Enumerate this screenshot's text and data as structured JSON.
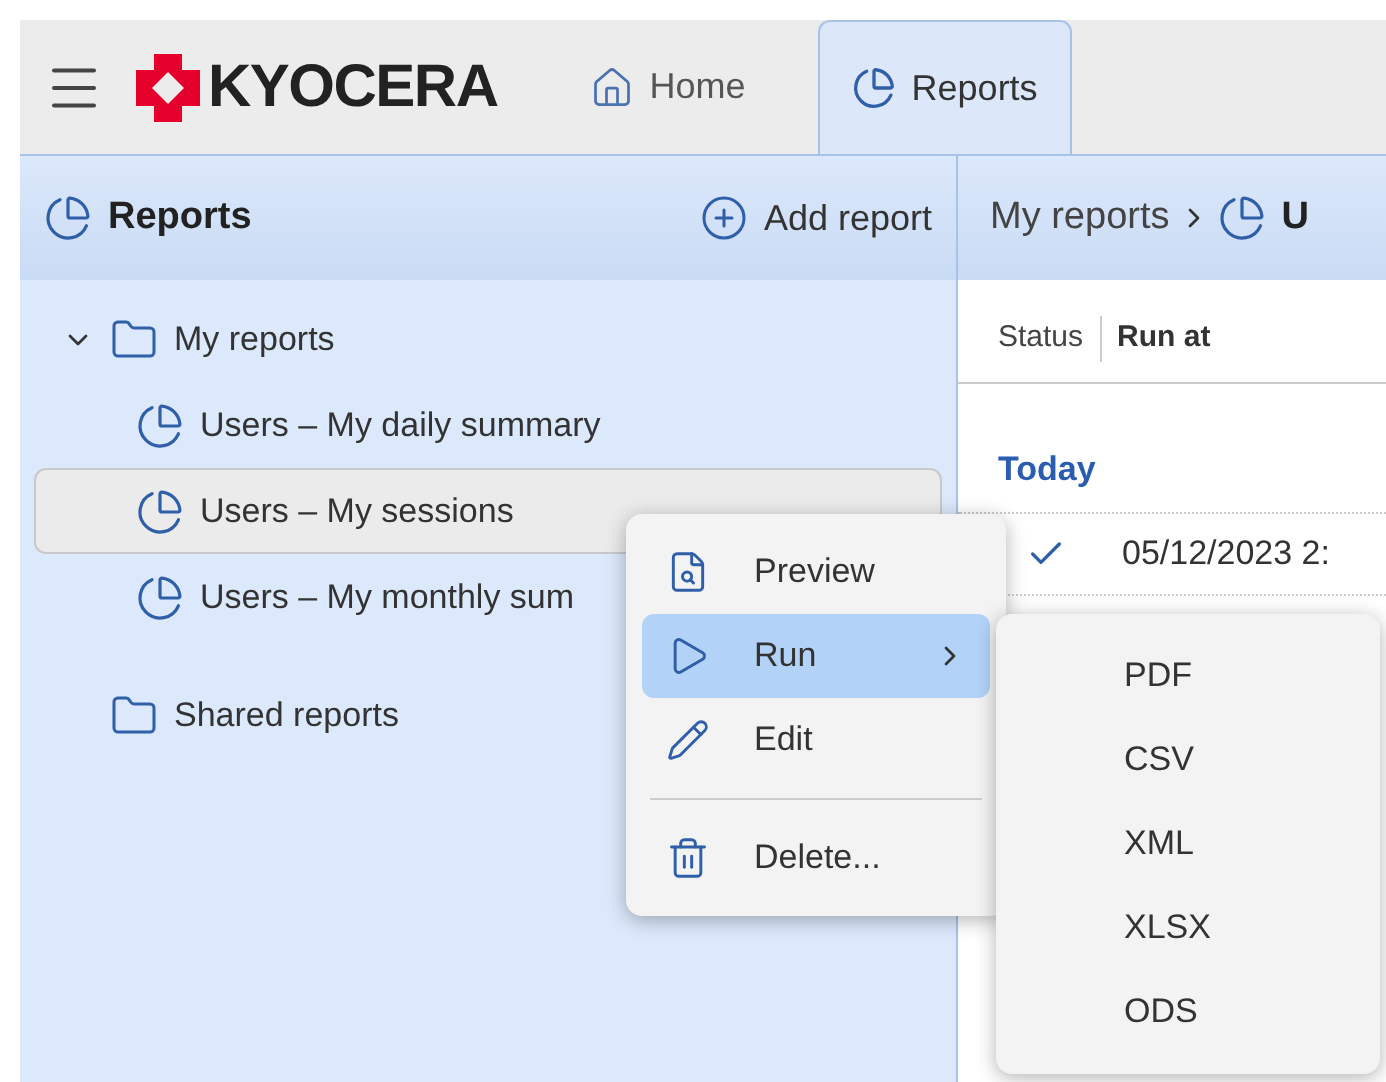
{
  "brand": {
    "logo_text": "KYOCERA"
  },
  "tabs": [
    {
      "label": "Home",
      "selected": false
    },
    {
      "label": "Reports",
      "selected": true
    }
  ],
  "sidebar": {
    "title": "Reports",
    "add_button": "Add report",
    "tree": [
      {
        "label": "My reports",
        "expanded": true,
        "selected": false,
        "children": [
          {
            "label": "Users – My daily summary",
            "selected": false
          },
          {
            "label": "Users – My sessions",
            "selected": true
          },
          {
            "label": "Users – My monthly sum",
            "selected": false
          }
        ]
      },
      {
        "label": "Shared reports",
        "expanded": false,
        "selected": false
      }
    ]
  },
  "main": {
    "breadcrumb": [
      "My reports",
      "U"
    ],
    "columns": [
      "Status",
      "Run at"
    ],
    "group": "Today",
    "rows": [
      {
        "done": true,
        "run_at": "05/12/2023 2:"
      }
    ]
  },
  "context_menu": {
    "items": [
      {
        "label": "Preview",
        "selected": false,
        "submenu": false
      },
      {
        "label": "Run",
        "selected": true,
        "submenu": true
      },
      {
        "label": "Edit",
        "selected": false,
        "submenu": false
      },
      {
        "label": "Delete...",
        "selected": false,
        "submenu": false,
        "separator_before": true
      }
    ]
  },
  "submenu": {
    "items": [
      "PDF",
      "CSV",
      "XML",
      "XLSX",
      "ODS"
    ]
  }
}
